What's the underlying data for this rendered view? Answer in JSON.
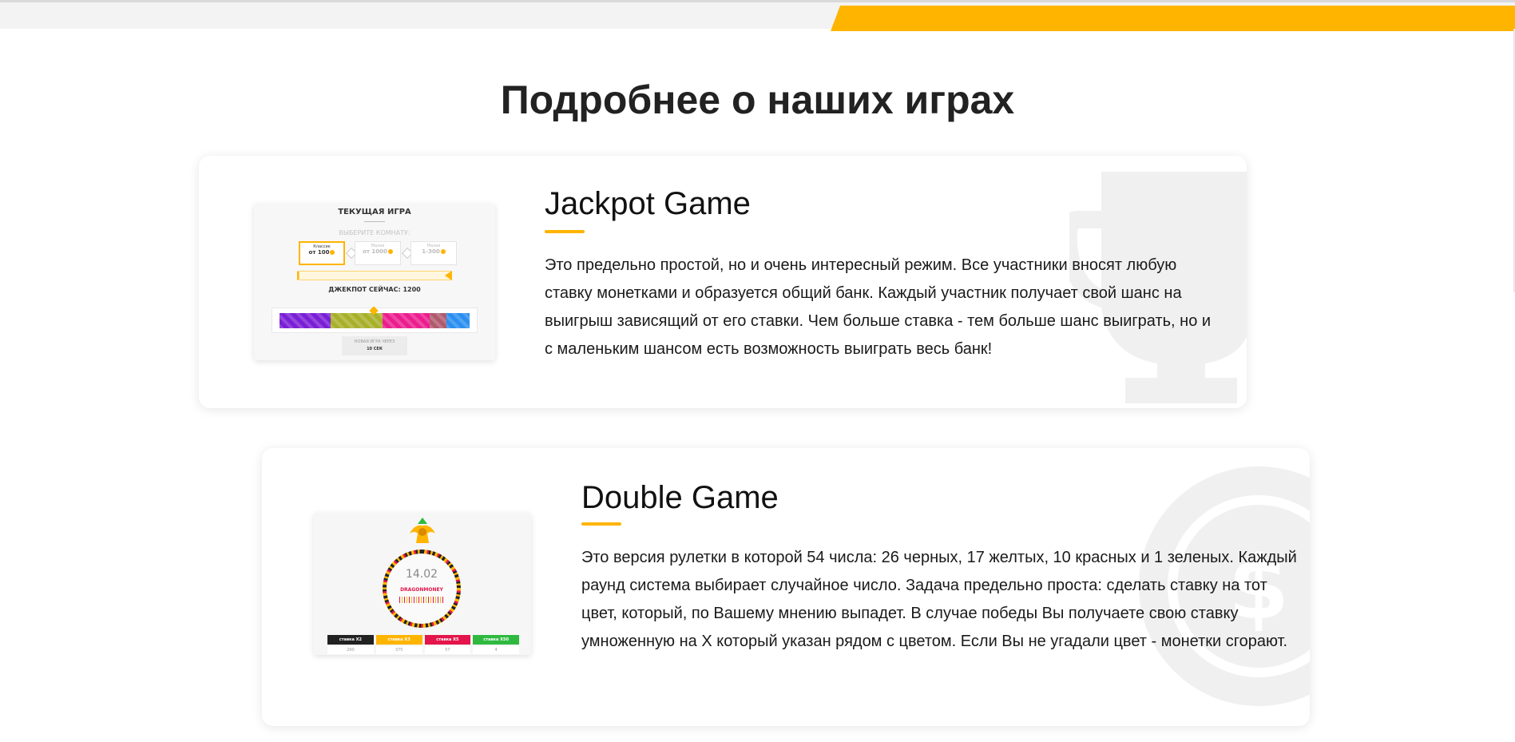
{
  "page": {
    "section_title": "Подробнее о наших играх",
    "colors": {
      "accent": "#ffb400",
      "topbar_bg": "#f3f3f3",
      "card_bg": "#ffffff",
      "watermark": "#f0f0f0"
    }
  },
  "games": [
    {
      "title": "Jackpot Game",
      "description": "Это предельно простой, но и очень интересный режим. Все участники вносят любую ставку монетками и образуется общий банк. Каждый участник получает свой шанс на выигрыш зависящий от его ставки. Чем больше ставка - тем больше шанс выиграть, но и с маленьким шансом есть возможность выиграть весь банк!",
      "watermark_icon": "trophy-icon",
      "preview": {
        "heading": "ТЕКУЩАЯ ИГРА",
        "subheading": "ВЫБЕРИТЕ КОМНАТУ:",
        "rooms": [
          {
            "name": "Классик",
            "value": "от 100"
          },
          {
            "name": "Малая",
            "value": "от 1000"
          },
          {
            "name": "Малая",
            "value": "1-300"
          }
        ],
        "jackpot_now": "ДЖЕКПОТ СЕЙЧАС: 1200",
        "footer_label": "НОВАЯ ИГРА ЧЕРЕЗ",
        "footer_value": "10 СЕК",
        "bar_colors": [
          "#7a1fd6",
          "#a8b02a",
          "#ec1e8f",
          "#b05a6e",
          "#2a8ff0"
        ]
      }
    },
    {
      "title": "Double Game",
      "description": "Это версия рулетки в которой 54 числа: 26 черных, 17 желтых, 10 красных и 1 зеленых. Каждый раунд система выбирает случайное число. Задача предельно проста: сделать ставку на тот цвет, который, по Вашему мнению выпадет. В случае победы Вы получаете свою ставку умноженную на Х который указан рядом с цветом. Если Вы не угадали цвет - монетки сгорают.",
      "watermark_icon": "coin-dollar-icon",
      "preview": {
        "timer": "14.02",
        "brand": "DRAGONMONEY",
        "bets": [
          {
            "label": "ставка X2",
            "color": "#222222",
            "total": "290"
          },
          {
            "label": "ставка X3",
            "color": "#ffb400",
            "total": "375"
          },
          {
            "label": "ставка X5",
            "color": "#e4154b",
            "total": "57"
          },
          {
            "label": "ставка X50",
            "color": "#2fba3f",
            "total": "4"
          }
        ]
      }
    }
  ]
}
